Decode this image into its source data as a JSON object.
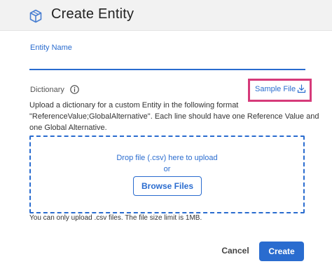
{
  "header": {
    "title": "Create Entity",
    "icon": "cube-icon"
  },
  "form": {
    "entity_name_label": "Entity Name",
    "entity_name_value": "",
    "dictionary_label": "Dictionary",
    "info_icon": "info-icon",
    "sample_file_label": "Sample File",
    "sample_file_icon": "download-icon",
    "description": "Upload a dictionary for a custom Entity in the following format \"ReferenceValue;GlobalAlternative\". Each line should have one Reference Value and one Global Alternative.",
    "dropzone": {
      "text": "Drop file (.csv) here to upload",
      "or": "or",
      "browse_label": "Browse Files"
    },
    "limit_text": "You can only upload .csv files. The file size limit is 1MB."
  },
  "footer": {
    "cancel_label": "Cancel",
    "create_label": "Create"
  },
  "colors": {
    "accent": "#2a6ccf",
    "highlight": "#d63a7a",
    "header_bg": "#f2f2f2"
  }
}
